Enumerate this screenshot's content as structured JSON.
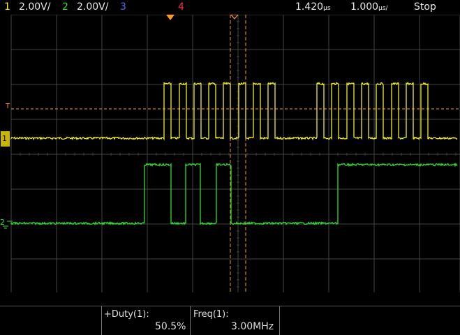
{
  "status_bar": {
    "ch1": {
      "num": "1",
      "scale": "2.00V/",
      "color": "#f2ee1e"
    },
    "ch2": {
      "num": "2",
      "scale": "2.00V/",
      "color": "#33dd33"
    },
    "ch3": {
      "num": "3",
      "color": "#4a6cff"
    },
    "ch4": {
      "num": "4",
      "color": "#ff3030"
    },
    "time_offset": "1.420",
    "time_offset_unit": "µs",
    "timebase": "1.000",
    "timebase_unit": "µs/",
    "run_state": "Stop"
  },
  "markers": {
    "ch1_marker": "1",
    "ch2_marker": "2",
    "trigger_marker": "T"
  },
  "colors": {
    "ch1": "#f2ee1e",
    "ch2": "#33dd33",
    "cursor": "#ff9a1a",
    "grid": "#4a4a4a"
  },
  "measurements": [
    {
      "label": "+Duty(1):",
      "value": "50.5%"
    },
    {
      "label": "Freq(1):",
      "value": "3.00MHz"
    }
  ]
}
